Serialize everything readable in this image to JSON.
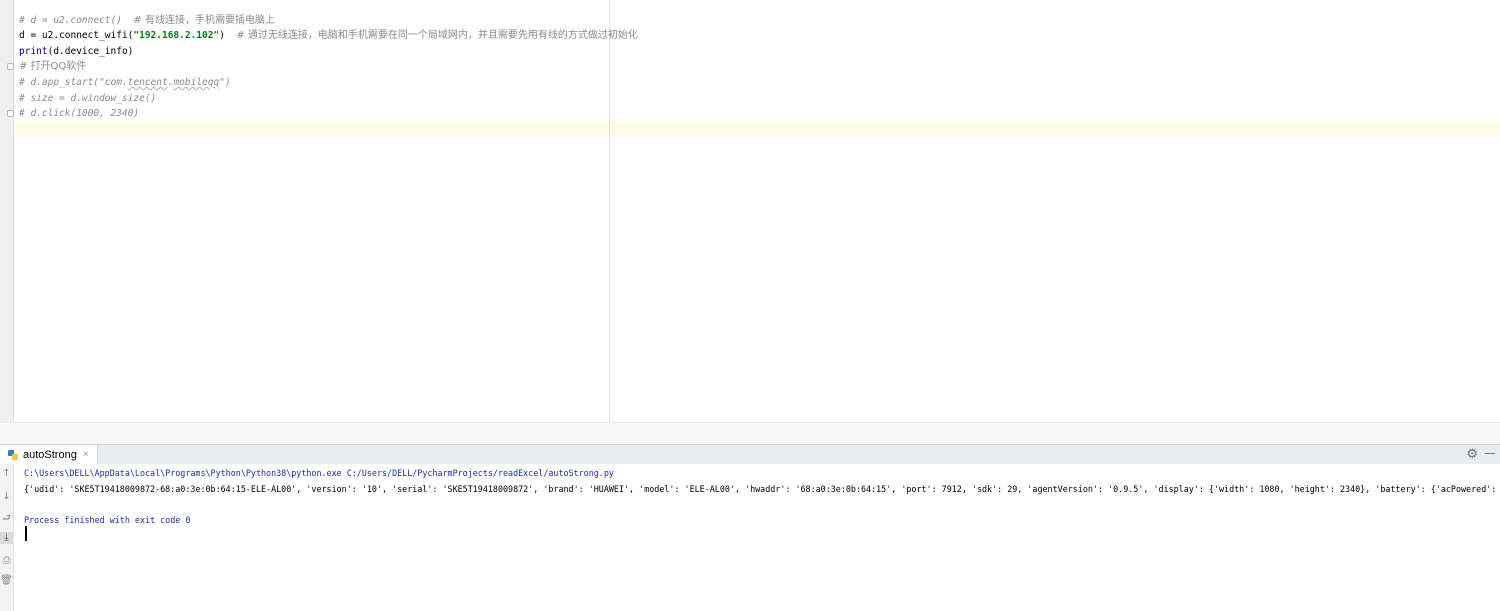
{
  "editor": {
    "line1_code": "# d = u2.connect()  ",
    "line1_comment": "# 有线连接，手机需要插电脑上",
    "line2_ident": "d = u2.connect_wifi(",
    "line2_string": "\"192.168.2.102\"",
    "line2_close": ")  ",
    "line2_comment": "# 通过无线连接，电脑和手机需要在同一个局域网内，并且需要先用有线的方式做过初始化",
    "line3_builtin": "print",
    "line3_rest": "(d.device_info)",
    "line4_comment": "# 打开QQ软件",
    "line5_prefix": "# d.app_start(\"com.",
    "line5_squiggle1": "tencent",
    "line5_dot": ".",
    "line5_squiggle2": "mobileqq",
    "line5_suffix": "\")",
    "line6_comment": "# size = d.window_size()",
    "line7_comment": "# d.click(1000, 2340)"
  },
  "run_panel": {
    "tab_label": "autoStrong",
    "tab_close": "×",
    "gear_glyph": "⚙",
    "minimize_glyph": "—",
    "toolbar": [
      "↑",
      "↓",
      "⮐",
      "⤓",
      "⎙",
      "🗑"
    ],
    "console": {
      "command": "C:\\Users\\DELL\\AppData\\Local\\Programs\\Python\\Python38\\python.exe C:/Users/DELL/PycharmProjects/readExcel/autoStrong.py",
      "output": "{'udid': 'SKE5T19418009872-68:a0:3e:0b:64:15-ELE-AL00', 'version': '10', 'serial': 'SKE5T19418009872', 'brand': 'HUAWEI', 'model': 'ELE-AL00', 'hwaddr': '68:a0:3e:0b:64:15', 'port': 7912, 'sdk': 29, 'agentVersion': '0.9.5', 'display': {'width': 1080, 'height': 2340}, 'battery': {'acPowered': False,",
      "finished": "Process finished with exit code 0"
    }
  },
  "colors": {
    "comment": "#8c8c8c",
    "string": "#067d17",
    "builtin": "#000080",
    "console_text": "#1f2ca3",
    "current_line": "#fffae3"
  }
}
